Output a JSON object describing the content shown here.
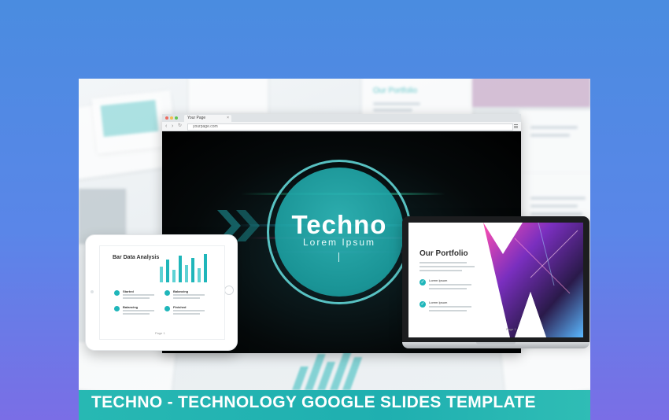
{
  "browser": {
    "tab_title": "Your Page",
    "tab_close": "×",
    "url": "yourpage.com",
    "nav_back": "‹",
    "nav_forward": "›",
    "nav_reload": "↻"
  },
  "hero_slide": {
    "title": "Techno",
    "subtitle": "Lorem Ipsum"
  },
  "tablet_slide": {
    "title": "Bar Data Analysis",
    "features": [
      {
        "label": "Started"
      },
      {
        "label": "Balancing"
      },
      {
        "label": "Balancing"
      },
      {
        "label": "Finished"
      }
    ],
    "bars": [
      0.55,
      0.8,
      0.45,
      0.95,
      0.6,
      0.85,
      0.5,
      1.0
    ],
    "page_label": "Page 1"
  },
  "laptop_slide": {
    "title": "Our Portfolio",
    "items": [
      {
        "label": "Lorem Ipsum"
      },
      {
        "label": "Lorem Ipsum"
      }
    ],
    "page_label": "Page 1"
  },
  "background_slide": {
    "title": "Our Portfolio"
  },
  "banner": {
    "title": "TECHNO - TECHNOLOGY GOOGLE SLIDES TEMPLATE"
  },
  "colors": {
    "accent": "#1fb6ba",
    "background_top": "#4a8ce0",
    "background_bottom": "#7a6ee6",
    "banner": "#27b8b3"
  }
}
